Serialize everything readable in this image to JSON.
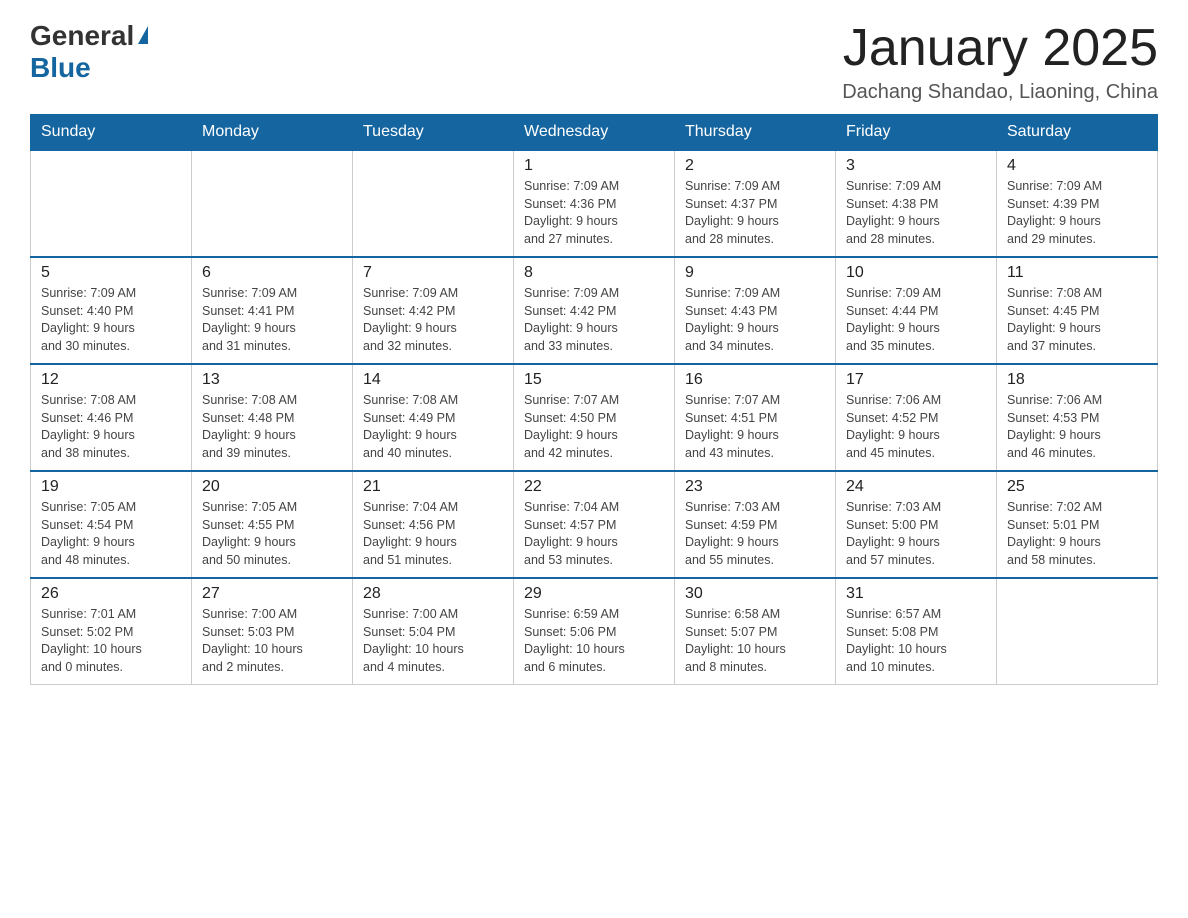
{
  "header": {
    "logo_general": "General",
    "logo_blue": "Blue",
    "month_title": "January 2025",
    "location": "Dachang Shandao, Liaoning, China"
  },
  "days_of_week": [
    "Sunday",
    "Monday",
    "Tuesday",
    "Wednesday",
    "Thursday",
    "Friday",
    "Saturday"
  ],
  "weeks": [
    [
      {
        "day": "",
        "info": ""
      },
      {
        "day": "",
        "info": ""
      },
      {
        "day": "",
        "info": ""
      },
      {
        "day": "1",
        "info": "Sunrise: 7:09 AM\nSunset: 4:36 PM\nDaylight: 9 hours\nand 27 minutes."
      },
      {
        "day": "2",
        "info": "Sunrise: 7:09 AM\nSunset: 4:37 PM\nDaylight: 9 hours\nand 28 minutes."
      },
      {
        "day": "3",
        "info": "Sunrise: 7:09 AM\nSunset: 4:38 PM\nDaylight: 9 hours\nand 28 minutes."
      },
      {
        "day": "4",
        "info": "Sunrise: 7:09 AM\nSunset: 4:39 PM\nDaylight: 9 hours\nand 29 minutes."
      }
    ],
    [
      {
        "day": "5",
        "info": "Sunrise: 7:09 AM\nSunset: 4:40 PM\nDaylight: 9 hours\nand 30 minutes."
      },
      {
        "day": "6",
        "info": "Sunrise: 7:09 AM\nSunset: 4:41 PM\nDaylight: 9 hours\nand 31 minutes."
      },
      {
        "day": "7",
        "info": "Sunrise: 7:09 AM\nSunset: 4:42 PM\nDaylight: 9 hours\nand 32 minutes."
      },
      {
        "day": "8",
        "info": "Sunrise: 7:09 AM\nSunset: 4:42 PM\nDaylight: 9 hours\nand 33 minutes."
      },
      {
        "day": "9",
        "info": "Sunrise: 7:09 AM\nSunset: 4:43 PM\nDaylight: 9 hours\nand 34 minutes."
      },
      {
        "day": "10",
        "info": "Sunrise: 7:09 AM\nSunset: 4:44 PM\nDaylight: 9 hours\nand 35 minutes."
      },
      {
        "day": "11",
        "info": "Sunrise: 7:08 AM\nSunset: 4:45 PM\nDaylight: 9 hours\nand 37 minutes."
      }
    ],
    [
      {
        "day": "12",
        "info": "Sunrise: 7:08 AM\nSunset: 4:46 PM\nDaylight: 9 hours\nand 38 minutes."
      },
      {
        "day": "13",
        "info": "Sunrise: 7:08 AM\nSunset: 4:48 PM\nDaylight: 9 hours\nand 39 minutes."
      },
      {
        "day": "14",
        "info": "Sunrise: 7:08 AM\nSunset: 4:49 PM\nDaylight: 9 hours\nand 40 minutes."
      },
      {
        "day": "15",
        "info": "Sunrise: 7:07 AM\nSunset: 4:50 PM\nDaylight: 9 hours\nand 42 minutes."
      },
      {
        "day": "16",
        "info": "Sunrise: 7:07 AM\nSunset: 4:51 PM\nDaylight: 9 hours\nand 43 minutes."
      },
      {
        "day": "17",
        "info": "Sunrise: 7:06 AM\nSunset: 4:52 PM\nDaylight: 9 hours\nand 45 minutes."
      },
      {
        "day": "18",
        "info": "Sunrise: 7:06 AM\nSunset: 4:53 PM\nDaylight: 9 hours\nand 46 minutes."
      }
    ],
    [
      {
        "day": "19",
        "info": "Sunrise: 7:05 AM\nSunset: 4:54 PM\nDaylight: 9 hours\nand 48 minutes."
      },
      {
        "day": "20",
        "info": "Sunrise: 7:05 AM\nSunset: 4:55 PM\nDaylight: 9 hours\nand 50 minutes."
      },
      {
        "day": "21",
        "info": "Sunrise: 7:04 AM\nSunset: 4:56 PM\nDaylight: 9 hours\nand 51 minutes."
      },
      {
        "day": "22",
        "info": "Sunrise: 7:04 AM\nSunset: 4:57 PM\nDaylight: 9 hours\nand 53 minutes."
      },
      {
        "day": "23",
        "info": "Sunrise: 7:03 AM\nSunset: 4:59 PM\nDaylight: 9 hours\nand 55 minutes."
      },
      {
        "day": "24",
        "info": "Sunrise: 7:03 AM\nSunset: 5:00 PM\nDaylight: 9 hours\nand 57 minutes."
      },
      {
        "day": "25",
        "info": "Sunrise: 7:02 AM\nSunset: 5:01 PM\nDaylight: 9 hours\nand 58 minutes."
      }
    ],
    [
      {
        "day": "26",
        "info": "Sunrise: 7:01 AM\nSunset: 5:02 PM\nDaylight: 10 hours\nand 0 minutes."
      },
      {
        "day": "27",
        "info": "Sunrise: 7:00 AM\nSunset: 5:03 PM\nDaylight: 10 hours\nand 2 minutes."
      },
      {
        "day": "28",
        "info": "Sunrise: 7:00 AM\nSunset: 5:04 PM\nDaylight: 10 hours\nand 4 minutes."
      },
      {
        "day": "29",
        "info": "Sunrise: 6:59 AM\nSunset: 5:06 PM\nDaylight: 10 hours\nand 6 minutes."
      },
      {
        "day": "30",
        "info": "Sunrise: 6:58 AM\nSunset: 5:07 PM\nDaylight: 10 hours\nand 8 minutes."
      },
      {
        "day": "31",
        "info": "Sunrise: 6:57 AM\nSunset: 5:08 PM\nDaylight: 10 hours\nand 10 minutes."
      },
      {
        "day": "",
        "info": ""
      }
    ]
  ]
}
